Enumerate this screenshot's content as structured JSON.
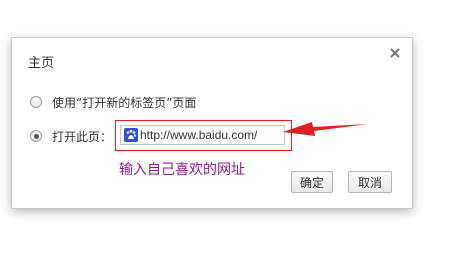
{
  "dialog": {
    "title": "主页",
    "close_icon": "close-icon"
  },
  "options": [
    {
      "label": "使用“打开新的标签页”页面",
      "selected": false
    },
    {
      "label": "打开此页：",
      "selected": true
    }
  ],
  "homepage_input": {
    "value": "http://www.baidu.com/",
    "favicon": "baidu-paw-icon",
    "favicon_color": "#2a4fd8"
  },
  "annotation": {
    "text": "输入自己喜欢的网址",
    "color": "#8b1a8b",
    "arrow_color": "#e02020"
  },
  "buttons": {
    "ok_label": "确定",
    "cancel_label": "取消"
  }
}
